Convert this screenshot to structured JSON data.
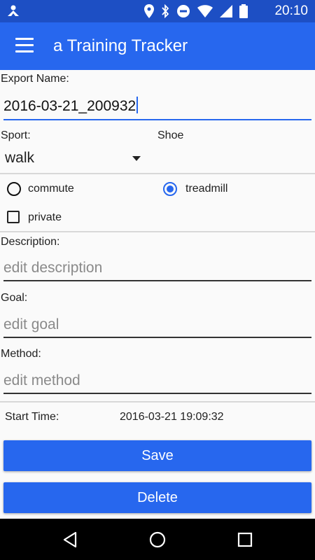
{
  "status_bar": {
    "time": "20:10",
    "icons": [
      "location-icon",
      "bluetooth-icon",
      "do-not-disturb-icon",
      "wifi-icon",
      "signal-icon",
      "battery-icon"
    ]
  },
  "app_bar": {
    "title": "a Training Tracker",
    "menu_icon": "menu-icon"
  },
  "form": {
    "export_name_label": "Export Name:",
    "export_name_value": "2016-03-21_200932",
    "sport_label": "Sport:",
    "sport_value": "walk",
    "shoe_label": "Shoe",
    "radio_commute_label": "commute",
    "radio_treadmill_label": "treadmill",
    "selected_radio": "treadmill",
    "private_label": "private",
    "private_checked": false,
    "description_label": "Description:",
    "description_placeholder": "edit description",
    "goal_label": "Goal:",
    "goal_placeholder": "edit goal",
    "method_label": "Method:",
    "method_placeholder": "edit method",
    "start_time_label": "Start Time:",
    "start_time_value": "2016-03-21 19:09:32"
  },
  "buttons": {
    "save_label": "Save",
    "delete_label": "Delete"
  },
  "colors": {
    "status_bar": "#1d4fc4",
    "app_bar": "#2767ee",
    "accent": "#2767ee"
  }
}
